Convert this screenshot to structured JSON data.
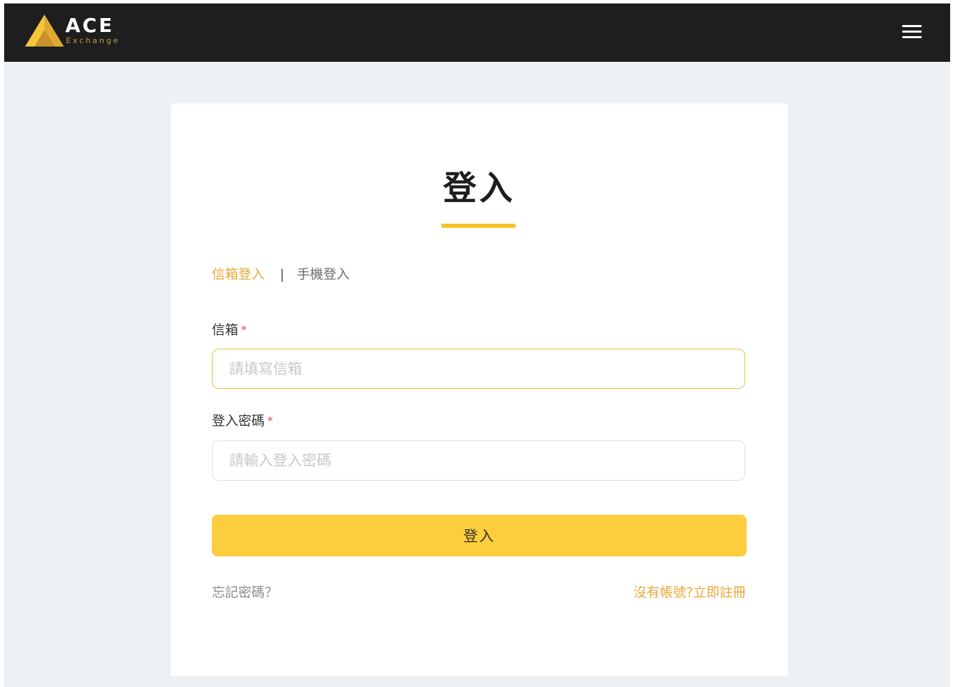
{
  "navbar": {
    "brand_name": "ACE",
    "brand_sub": "Exchange",
    "menu_icon": "hamburger-menu-icon",
    "logo_colors": {
      "gold": "#f4c53b",
      "gold_dark": "#c9932a"
    },
    "background": "#1e1e21"
  },
  "login": {
    "title": "登入",
    "tabs": {
      "email": "信箱登入",
      "separator": "|",
      "phone": "手機登入"
    },
    "email": {
      "label": "信箱",
      "required_mark": "*",
      "placeholder": "請填寫信箱",
      "value": ""
    },
    "password": {
      "label": "登入密碼",
      "required_mark": "*",
      "placeholder": "請輸入登入密碼",
      "value": ""
    },
    "submit_label": "登入",
    "forgot_password": "忘記密碼？",
    "register_link": "沒有帳號?立即註冊"
  },
  "colors": {
    "accent": "#fccd3c",
    "link": "#e8a93a",
    "required": "#e0453a",
    "page_background": "#edf1f4"
  }
}
